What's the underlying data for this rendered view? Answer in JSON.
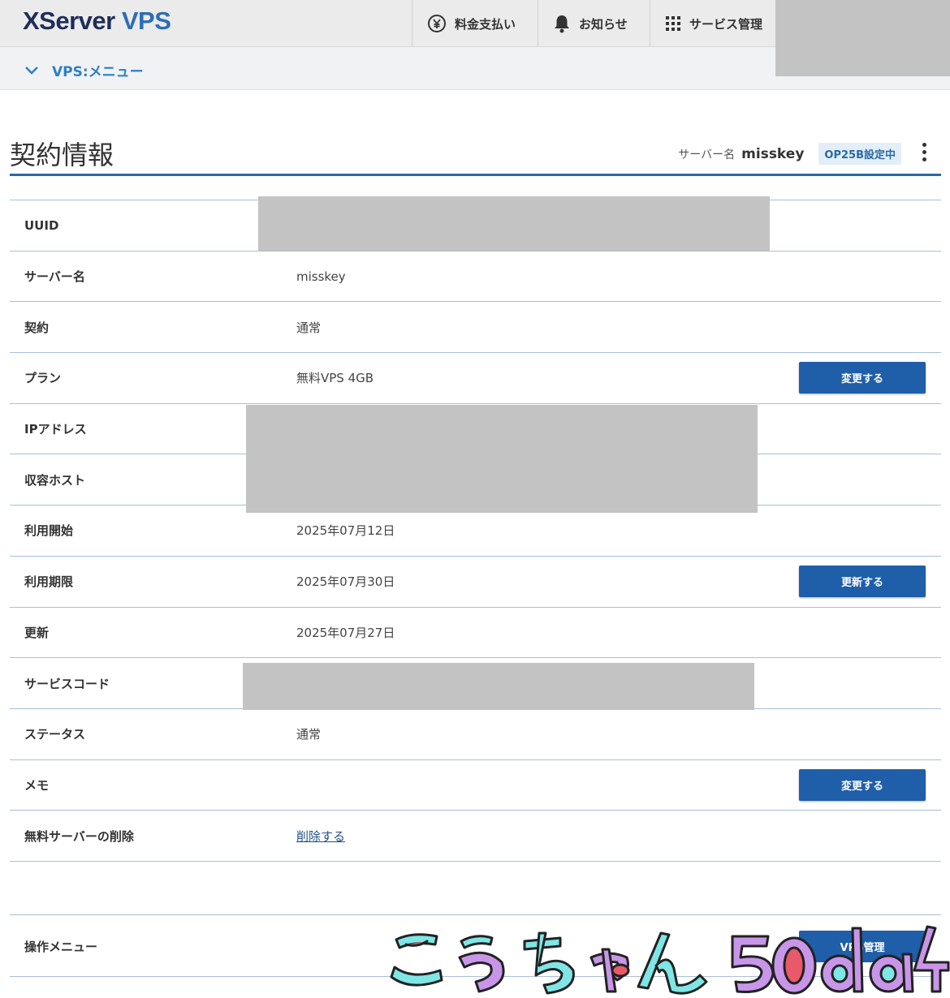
{
  "header": {
    "logo_part1": "XServer",
    "logo_part2": "VPS",
    "nav": {
      "payment": "料金支払い",
      "notice": "お知らせ",
      "services": "サービス管理"
    }
  },
  "submenu": {
    "label": "VPS:メニュー"
  },
  "page": {
    "title": "契約情報",
    "server_label": "サーバー名",
    "server_name": "misskey",
    "badge": "OP25B設定中"
  },
  "rows": [
    {
      "label": "UUID",
      "value": ""
    },
    {
      "label": "サーバー名",
      "value": "misskey"
    },
    {
      "label": "契約",
      "value": "通常"
    },
    {
      "label": "プラン",
      "value": "無料VPS 4GB",
      "button": "変更する"
    },
    {
      "label": "IPアドレス",
      "value": ""
    },
    {
      "label": "収容ホスト",
      "value": ""
    },
    {
      "label": "利用開始",
      "value": "2025年07月12日"
    },
    {
      "label": "利用期限",
      "value": "2025年07月30日",
      "button": "更新する"
    },
    {
      "label": "更新",
      "value": "2025年07月27日"
    },
    {
      "label": "サービスコード",
      "value": ""
    },
    {
      "label": "ステータス",
      "value": "通常"
    },
    {
      "label": "メモ",
      "value": "",
      "button": "変更する"
    },
    {
      "label": "無料サーバーの削除",
      "link": "削除する"
    }
  ],
  "operations": {
    "label": "操作メニュー",
    "button": "VPS管理"
  },
  "signature": "こうちゃん50da4",
  "colors": {
    "accent": "#2a69a6",
    "button": "#1f5ea8",
    "link": "#2f7fc2"
  }
}
